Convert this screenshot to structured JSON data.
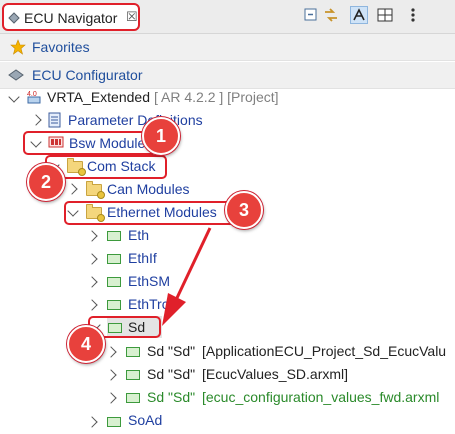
{
  "tab": {
    "title": "ECU Navigator",
    "close": "☒"
  },
  "toolbar": {
    "icons": [
      "collapse-all-icon",
      "link-with-editor-icon",
      "filter-icon",
      "layout-icon",
      "view-menu-icon"
    ]
  },
  "sections": {
    "favorites": "Favorites",
    "configurator": "ECU Configurator"
  },
  "tree": {
    "project": {
      "name": "VRTA_Extended",
      "meta": "[ AR 4.2.2 ] [Project]"
    },
    "param_defs": "Parameter Definitions",
    "bsw": "Bsw Modules",
    "com_stack": "Com Stack",
    "can_modules": "Can Modules",
    "eth_modules": "Ethernet Modules",
    "eth_items": [
      "Eth",
      "EthIf",
      "EthSM",
      "EthTrcv"
    ],
    "sd": "Sd",
    "sd_children": [
      {
        "name": "Sd \"Sd\"",
        "detail": "[ApplicationECU_Project_Sd_EcucValu"
      },
      {
        "name": "Sd \"Sd\"",
        "detail": "[EcucValues_SD.arxml]"
      },
      {
        "name": "Sd \"Sd\"",
        "detail": "[ecuc_configuration_values_fwd.arxml"
      }
    ],
    "soad": "SoAd"
  },
  "badges": [
    "1",
    "2",
    "3",
    "4"
  ],
  "colors": {
    "highlight": "#e0202a",
    "badge": "#e8413c"
  }
}
